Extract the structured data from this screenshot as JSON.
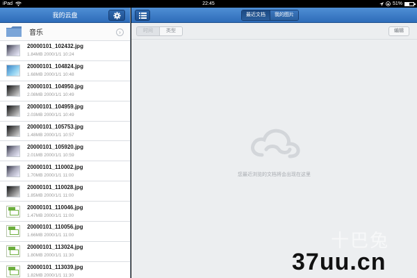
{
  "status_bar": {
    "device": "iPad",
    "wifi_icon": "wifi-icon",
    "time": "22:45",
    "battery_percent": "51%",
    "battery_level": 0.51
  },
  "sidebar": {
    "title": "我的云盘",
    "settings_icon": "gear-icon",
    "folder": {
      "label": "音乐",
      "icon": "folder-icon"
    },
    "files": [
      {
        "name": "20000101_102432.jpg",
        "meta": "1.84MB 2000/1/1 10:24",
        "thumb": "t-grey"
      },
      {
        "name": "20000101_104824.jpg",
        "meta": "1.68MB 2000/1/1 10:48",
        "thumb": "t-blue"
      },
      {
        "name": "20000101_104950.jpg",
        "meta": "2.08MB 2000/1/1 10:49",
        "thumb": "t-dark"
      },
      {
        "name": "20000101_104959.jpg",
        "meta": "2.03MB 2000/1/1 10:49",
        "thumb": "t-dark"
      },
      {
        "name": "20000101_105753.jpg",
        "meta": "1.48MB 2000/1/1 10:57",
        "thumb": "t-dark"
      },
      {
        "name": "20000101_105920.jpg",
        "meta": "2.01MB 2000/1/1 10:59",
        "thumb": "t-grey"
      },
      {
        "name": "20000101_110002.jpg",
        "meta": "1.70MB 2000/1/1 11:00",
        "thumb": "t-grey"
      },
      {
        "name": "20000101_110028.jpg",
        "meta": "1.85MB 2000/1/1 11:00",
        "thumb": "t-dark"
      },
      {
        "name": "20000101_110046.jpg",
        "meta": "1.47MB 2000/1/1 11:00",
        "thumb": "jpg"
      },
      {
        "name": "20000101_110056.jpg",
        "meta": "1.66MB 2000/1/1 11:00",
        "thumb": "jpg"
      },
      {
        "name": "20000101_113024.jpg",
        "meta": "1.80MB 2000/1/1 11:30",
        "thumb": "jpg"
      },
      {
        "name": "20000101_113039.jpg",
        "meta": "1.82MB 2000/1/1 11:30",
        "thumb": "jpg"
      }
    ]
  },
  "main": {
    "list_icon": "list-icon",
    "tabs": [
      {
        "label": "最近文档",
        "active": true
      },
      {
        "label": "我的图片",
        "active": false
      }
    ],
    "filters": [
      {
        "label": "时间",
        "active": true
      },
      {
        "label": "类型",
        "active": false
      }
    ],
    "edit_label": "编辑",
    "empty_icon": "cloud-icon",
    "empty_text": "您最近浏览的文档将会出现在这里"
  },
  "watermark": {
    "line1": "十巴兔",
    "line2": "37uu.cn"
  },
  "colors": {
    "bar_blue": "#3a7cc8",
    "panel_bg": "#eceef0"
  }
}
